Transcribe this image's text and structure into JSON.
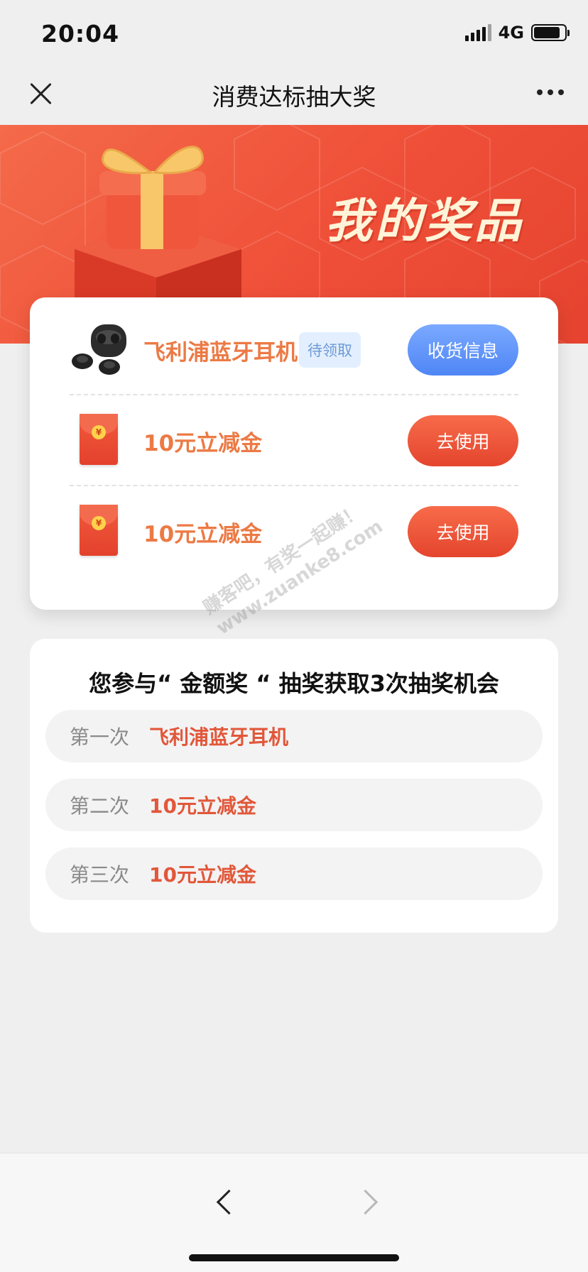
{
  "status_bar": {
    "time": "20:04",
    "network": "4G",
    "signal_icon": "signal-bars-icon",
    "battery_icon": "battery-icon"
  },
  "navbar": {
    "title": "消费达标抽大奖",
    "close_icon": "close-icon",
    "more_icon": "more-dots-icon"
  },
  "banner": {
    "title": "我的奖品",
    "gift_icon": "gift-box-icon"
  },
  "prizes": [
    {
      "name": "飞利浦蓝牙耳机",
      "tag": "待领取",
      "button": "收货信息",
      "icon": "earbuds-icon"
    },
    {
      "name": "10元立减金",
      "button": "去使用",
      "icon": "red-envelope-icon"
    },
    {
      "name": "10元立减金",
      "button": "去使用",
      "icon": "red-envelope-icon"
    }
  ],
  "rules": {
    "title": "您参与“ 金额奖 “ 抽奖获取3次抽奖机会",
    "rounds": [
      {
        "label": "第一次",
        "prize": "飞利浦蓝牙耳机"
      },
      {
        "label": "第二次",
        "prize": "10元立减金"
      },
      {
        "label": "第三次",
        "prize": "10元立减金"
      }
    ]
  },
  "watermark": {
    "line1": "赚客吧，有奖一起赚！",
    "line2": "www.zuanke8.com"
  },
  "coin_symbol": "¥",
  "colors": {
    "banner": "#ef4f38",
    "prize_text": "#ec7a45",
    "blue_button": "#4f86f5",
    "red_button": "#e4452d",
    "round_prize": "#e2573a"
  }
}
